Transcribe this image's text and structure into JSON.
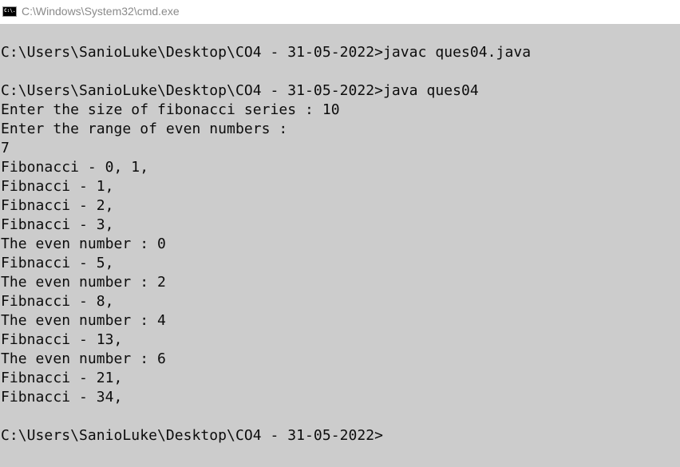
{
  "window": {
    "title": "C:\\Windows\\System32\\cmd.exe",
    "icon_name": "cmd-icon",
    "icon_text": "C:\\."
  },
  "console": {
    "background_color": "#cccccc",
    "text_color": "#0c0c0c",
    "lines": [
      "",
      "C:\\Users\\SanioLuke\\Desktop\\CO4 - 31-05-2022>javac ques04.java",
      "",
      "C:\\Users\\SanioLuke\\Desktop\\CO4 - 31-05-2022>java ques04",
      "Enter the size of fibonacci series : 10",
      "Enter the range of even numbers :",
      "7",
      "Fibonacci - 0, 1,",
      "Fibnacci - 1,",
      "Fibnacci - 2,",
      "Fibnacci - 3,",
      "The even number : 0",
      "Fibnacci - 5,",
      "The even number : 2",
      "Fibnacci - 8,",
      "The even number : 4",
      "Fibnacci - 13,",
      "The even number : 6",
      "Fibnacci - 21,",
      "Fibnacci - 34,",
      "",
      "C:\\Users\\SanioLuke\\Desktop\\CO4 - 31-05-2022>"
    ]
  }
}
